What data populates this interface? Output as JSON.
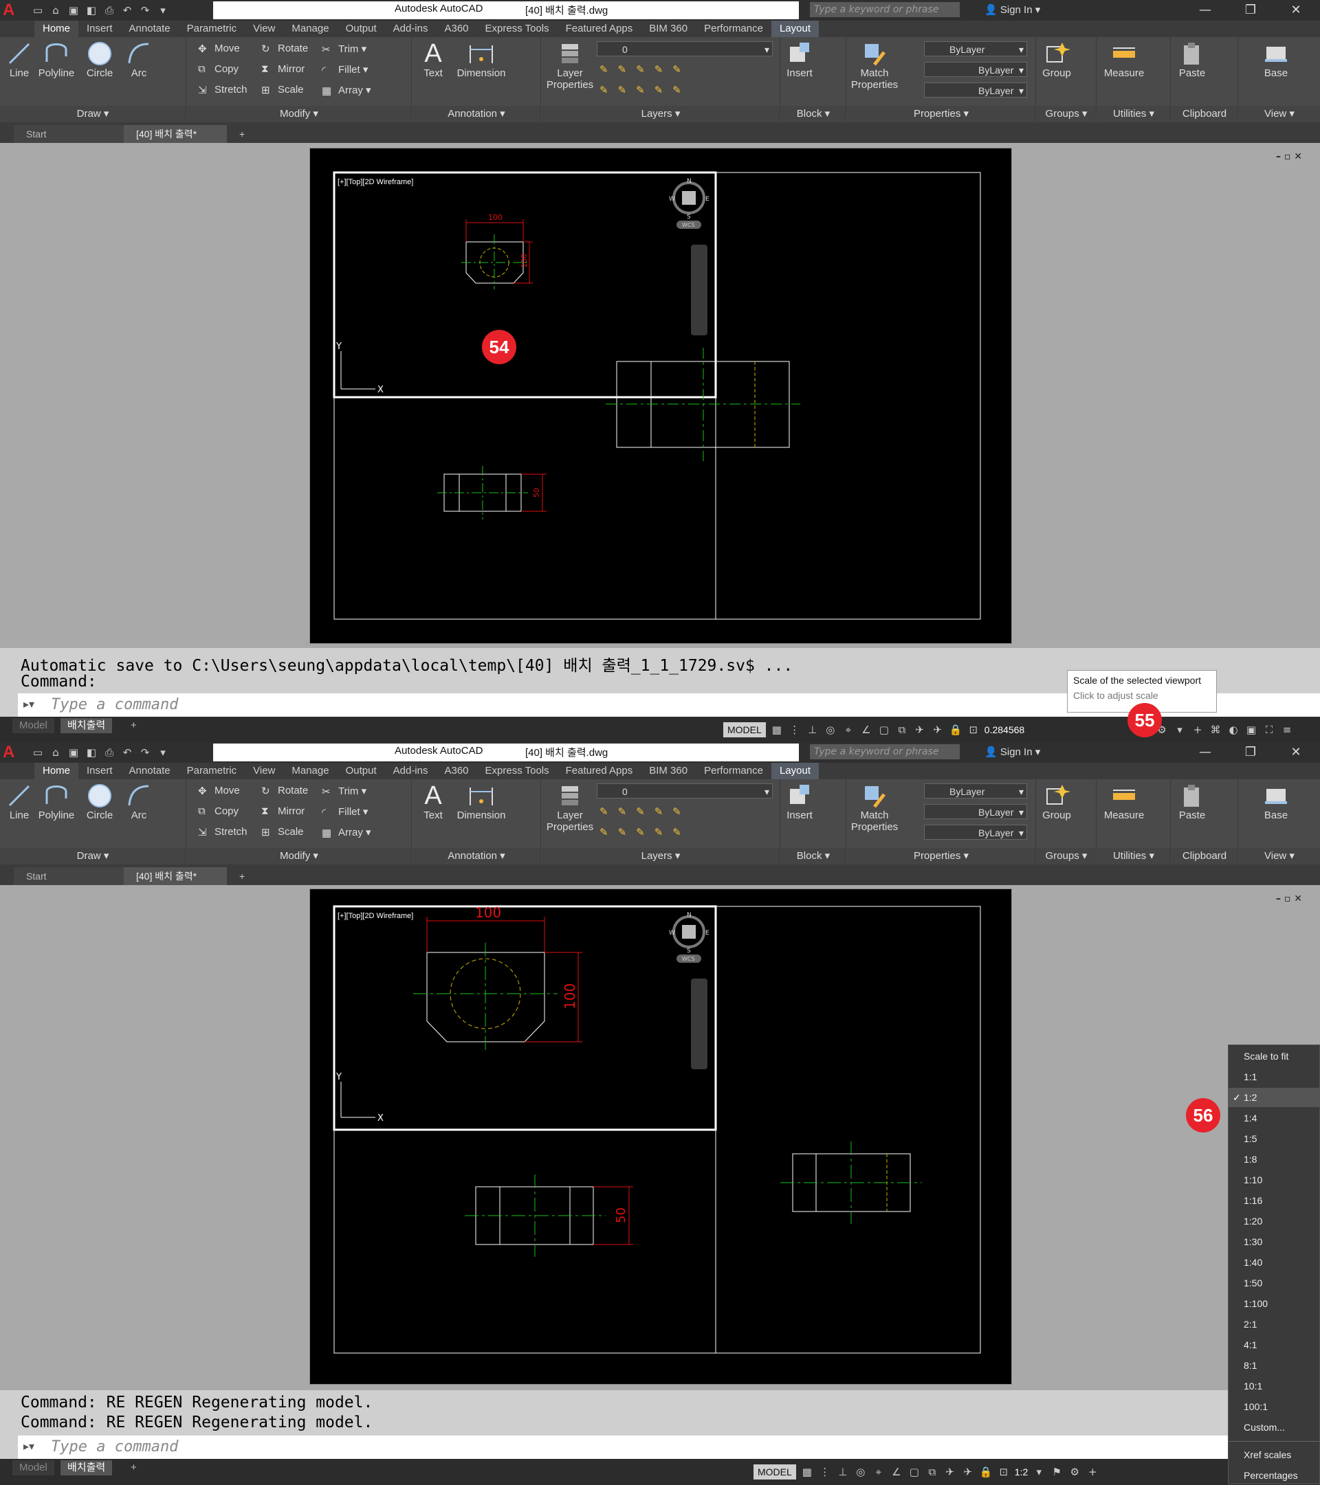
{
  "app": {
    "title": "Autodesk AutoCAD",
    "document": "[40] 배치 출력.dwg",
    "search_placeholder": "Type a keyword or phrase",
    "sign_in": "Sign In"
  },
  "tabs": [
    "Home",
    "Insert",
    "Annotate",
    "Parametric",
    "View",
    "Manage",
    "Output",
    "Add-ins",
    "A360",
    "Express Tools",
    "Featured Apps",
    "BIM 360",
    "Performance",
    "Layout"
  ],
  "ribbon": {
    "draw": {
      "title": "Draw",
      "line": "Line",
      "polyline": "Polyline",
      "circle": "Circle",
      "arc": "Arc"
    },
    "modify": {
      "title": "Modify",
      "move": "Move",
      "rotate": "Rotate",
      "trim": "Trim",
      "copy": "Copy",
      "mirror": "Mirror",
      "fillet": "Fillet",
      "stretch": "Stretch",
      "scale": "Scale",
      "array": "Array"
    },
    "annotation": {
      "title": "Annotation",
      "text": "Text",
      "dimension": "Dimension"
    },
    "layers": {
      "title": "Layers",
      "layer_properties_1": "Layer",
      "layer_properties_2": "Properties",
      "current_layer": "0"
    },
    "block": {
      "title": "Block",
      "insert": "Insert"
    },
    "properties": {
      "title": "Properties",
      "match_1": "Match",
      "match_2": "Properties",
      "color": "ByLayer",
      "linetype": "ByLayer",
      "lineweight": "ByLayer"
    },
    "groups": {
      "title": "Groups",
      "group": "Group"
    },
    "utilities": {
      "title": "Utilities",
      "measure": "Measure"
    },
    "clipboard": {
      "title": "Clipboard",
      "paste": "Paste"
    },
    "view": {
      "title": "View",
      "base": "Base"
    }
  },
  "file_tabs": {
    "start": "Start",
    "doc": "[40] 배치 출력*"
  },
  "viewport": {
    "label": "[+][Top][2D Wireframe]",
    "wcs": "WCS",
    "compass_n": "N",
    "compass_s": "S",
    "compass_w": "W",
    "compass_e": "E",
    "compass_top": "TOP",
    "axis_y": "Y",
    "axis_x": "X"
  },
  "dimensions": {
    "width": "100",
    "height": "100",
    "side": "50"
  },
  "panel1": {
    "cmd_line1": "Automatic save to C:\\Users\\seung\\appdata\\local\\temp\\[40] 배치 출력_1_1_1729.sv$ ...",
    "cmd_line2": "Command:",
    "tooltip_title": "Scale of the selected viewport",
    "tooltip_sub": "Click to adjust scale",
    "scale_value": "0.284568",
    "badge_a": "54",
    "badge_b": "55"
  },
  "panel2": {
    "cmd_line1": "Command: RE REGEN Regenerating model.",
    "cmd_line2": "Command: RE REGEN Regenerating model.",
    "scale_value": "1:2",
    "badge": "56"
  },
  "command_placeholder": "Type a command",
  "status": {
    "model_tab": "Model",
    "layout_tab": "배치출력",
    "model_button": "MODEL"
  },
  "scale_menu": {
    "items": [
      "Scale to fit",
      "1:1",
      "1:2",
      "1:4",
      "1:5",
      "1:8",
      "1:10",
      "1:16",
      "1:20",
      "1:30",
      "1:40",
      "1:50",
      "1:100",
      "2:1",
      "4:1",
      "8:1",
      "10:1",
      "100:1",
      "Custom..."
    ],
    "selected": "1:2",
    "extra": [
      "Xref scales",
      "Percentages"
    ]
  },
  "colors": {
    "dim": "#e01010",
    "center": "#19c219",
    "hidden": "#c9b400",
    "object": "#ffffff",
    "badge": "#e8222a"
  }
}
